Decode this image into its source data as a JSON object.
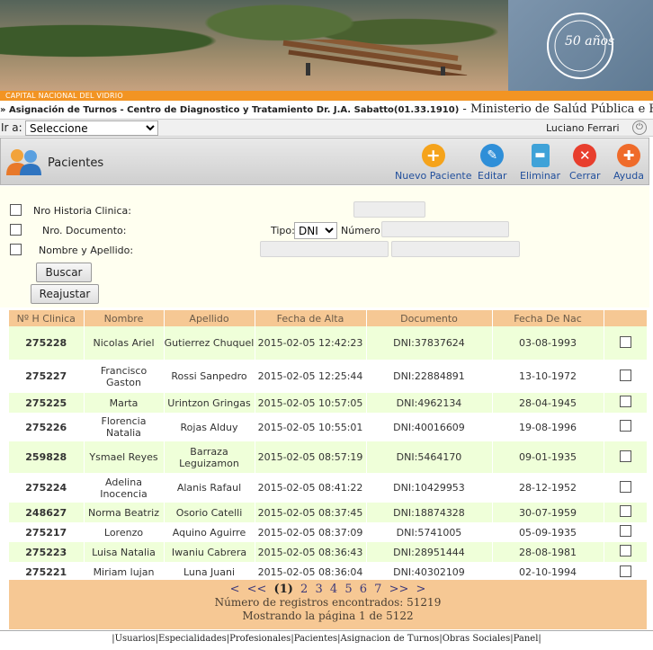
{
  "banner": {
    "city_label": "CAPITAL NACIONAL DEL VIDRIO",
    "badge_text": "50 años"
  },
  "title_line": {
    "arrow": "»",
    "main": "Asignación de Turnos - Centro de Diagnostico y Tratamiento Dr. J.A. Sabatto(01.33.1910)",
    "ministry": " - Ministerio de Salúd Pública e Higiene"
  },
  "nav": {
    "goto_label": "Ir a:",
    "goto_value": "Seleccione",
    "user_name": "Luciano Ferrari"
  },
  "toolbar": {
    "module_title": "Pacientes",
    "buttons": [
      {
        "label": "Nuevo Paciente",
        "icon": "plus-icon",
        "color": "#f5a31b"
      },
      {
        "label": "Editar",
        "icon": "pencil-icon",
        "color": "#2f8fd8"
      },
      {
        "label": "Eliminar",
        "icon": "trash-icon",
        "color": "#3fa2d8"
      },
      {
        "label": "Cerrar",
        "icon": "close-icon",
        "color": "#e83e2d"
      },
      {
        "label": "Ayuda",
        "icon": "lifebuoy-icon",
        "color": "#ef6b2a"
      }
    ]
  },
  "search": {
    "historia_label": "Nro Historia Clinica:",
    "documento_label": "Nro. Documento:",
    "tipo_label": "Tipo:",
    "tipo_value": "DNI",
    "numero_label": "Número:",
    "nombre_label": "Nombre y Apellido:",
    "buscar_label": "Buscar",
    "reajustar_label": "Reajustar"
  },
  "table": {
    "headers": [
      "Nº H Clinica",
      "Nombre",
      "Apellido",
      "Fecha de Alta",
      "Documento",
      "Fecha De Nac",
      ""
    ],
    "rows": [
      {
        "hc": "275228",
        "nombre": "Nicolas Ariel",
        "apellido": "Gutierrez Chuquel",
        "alta": "2015-02-05 12:42:23",
        "doc": "DNI:37837624",
        "nac": "03-08-1993"
      },
      {
        "hc": "275227",
        "nombre": "Francisco Gaston",
        "apellido": "Rossi Sanpedro",
        "alta": "2015-02-05 12:25:44",
        "doc": "DNI:22884891",
        "nac": "13-10-1972"
      },
      {
        "hc": "275225",
        "nombre": "Marta",
        "apellido": "Urintzon Gringas",
        "alta": "2015-02-05 10:57:05",
        "doc": "DNI:4962134",
        "nac": "28-04-1945"
      },
      {
        "hc": "275226",
        "nombre": "Florencia Natalia",
        "apellido": "Rojas Alduy",
        "alta": "2015-02-05 10:55:01",
        "doc": "DNI:40016609",
        "nac": "19-08-1996"
      },
      {
        "hc": "259828",
        "nombre": "Ysmael Reyes",
        "apellido": "Barraza Leguizamon",
        "alta": "2015-02-05 08:57:19",
        "doc": "DNI:5464170",
        "nac": "09-01-1935"
      },
      {
        "hc": "275224",
        "nombre": "Adelina Inocencia",
        "apellido": "Alanis Rafaul",
        "alta": "2015-02-05 08:41:22",
        "doc": "DNI:10429953",
        "nac": "28-12-1952"
      },
      {
        "hc": "248627",
        "nombre": "Norma Beatriz",
        "apellido": "Osorio Catelli",
        "alta": "2015-02-05 08:37:45",
        "doc": "DNI:18874328",
        "nac": "30-07-1959"
      },
      {
        "hc": "275217",
        "nombre": "Lorenzo",
        "apellido": "Aquino Aguirre",
        "alta": "2015-02-05 08:37:09",
        "doc": "DNI:5741005",
        "nac": "05-09-1935"
      },
      {
        "hc": "275223",
        "nombre": "Luisa Natalia",
        "apellido": "Iwaniu Cabrera",
        "alta": "2015-02-05 08:36:43",
        "doc": "DNI:28951444",
        "nac": "28-08-1981"
      },
      {
        "hc": "275221",
        "nombre": "Miriam lujan",
        "apellido": "Luna Juani",
        "alta": "2015-02-05 08:36:04",
        "doc": "DNI:40302109",
        "nac": "02-10-1994"
      }
    ]
  },
  "pager": {
    "first": "<",
    "prev": "<<",
    "current": "(1)",
    "pages": [
      "2",
      "3",
      "4",
      "5",
      "6",
      "7"
    ],
    "next": ">>",
    "last": ">",
    "records": "Número de registros encontrados: 51219",
    "showing": "Mostrando la página 1 de 5122"
  },
  "footer_links": [
    "Usuarios",
    "Especialidades",
    "Profesionales",
    "Pacientes",
    "Asignacion de Turnos",
    "Obras Sociales",
    "Panel"
  ]
}
